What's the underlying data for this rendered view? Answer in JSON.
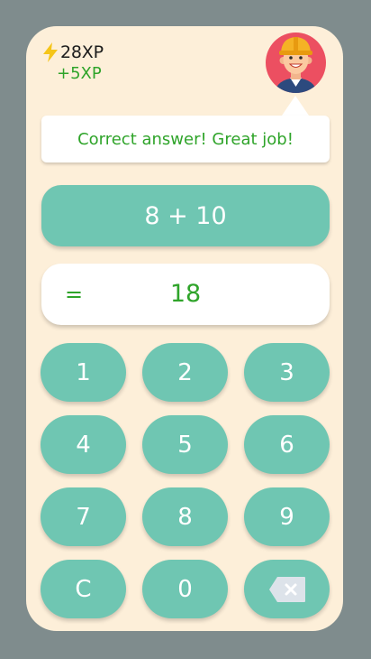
{
  "header": {
    "xp_total": "28XP",
    "xp_gain": "+5XP",
    "icon": "lightning-bolt-icon",
    "avatar": "worker-avatar"
  },
  "feedback": {
    "message": "Correct answer! Great job!"
  },
  "question": {
    "expression": "8 + 10"
  },
  "answer": {
    "equals": "=",
    "value": "18"
  },
  "keypad": {
    "keys": [
      "1",
      "2",
      "3",
      "4",
      "5",
      "6",
      "7",
      "8",
      "9",
      "C",
      "0"
    ],
    "backspace_icon": "backspace-icon"
  },
  "colors": {
    "background": "#7f8c8d",
    "card": "#fdefd9",
    "teal": "#6fc6b2",
    "success_green": "#2fa42a",
    "avatar_bg": "#ec4f61",
    "bolt": "#f5c518"
  }
}
